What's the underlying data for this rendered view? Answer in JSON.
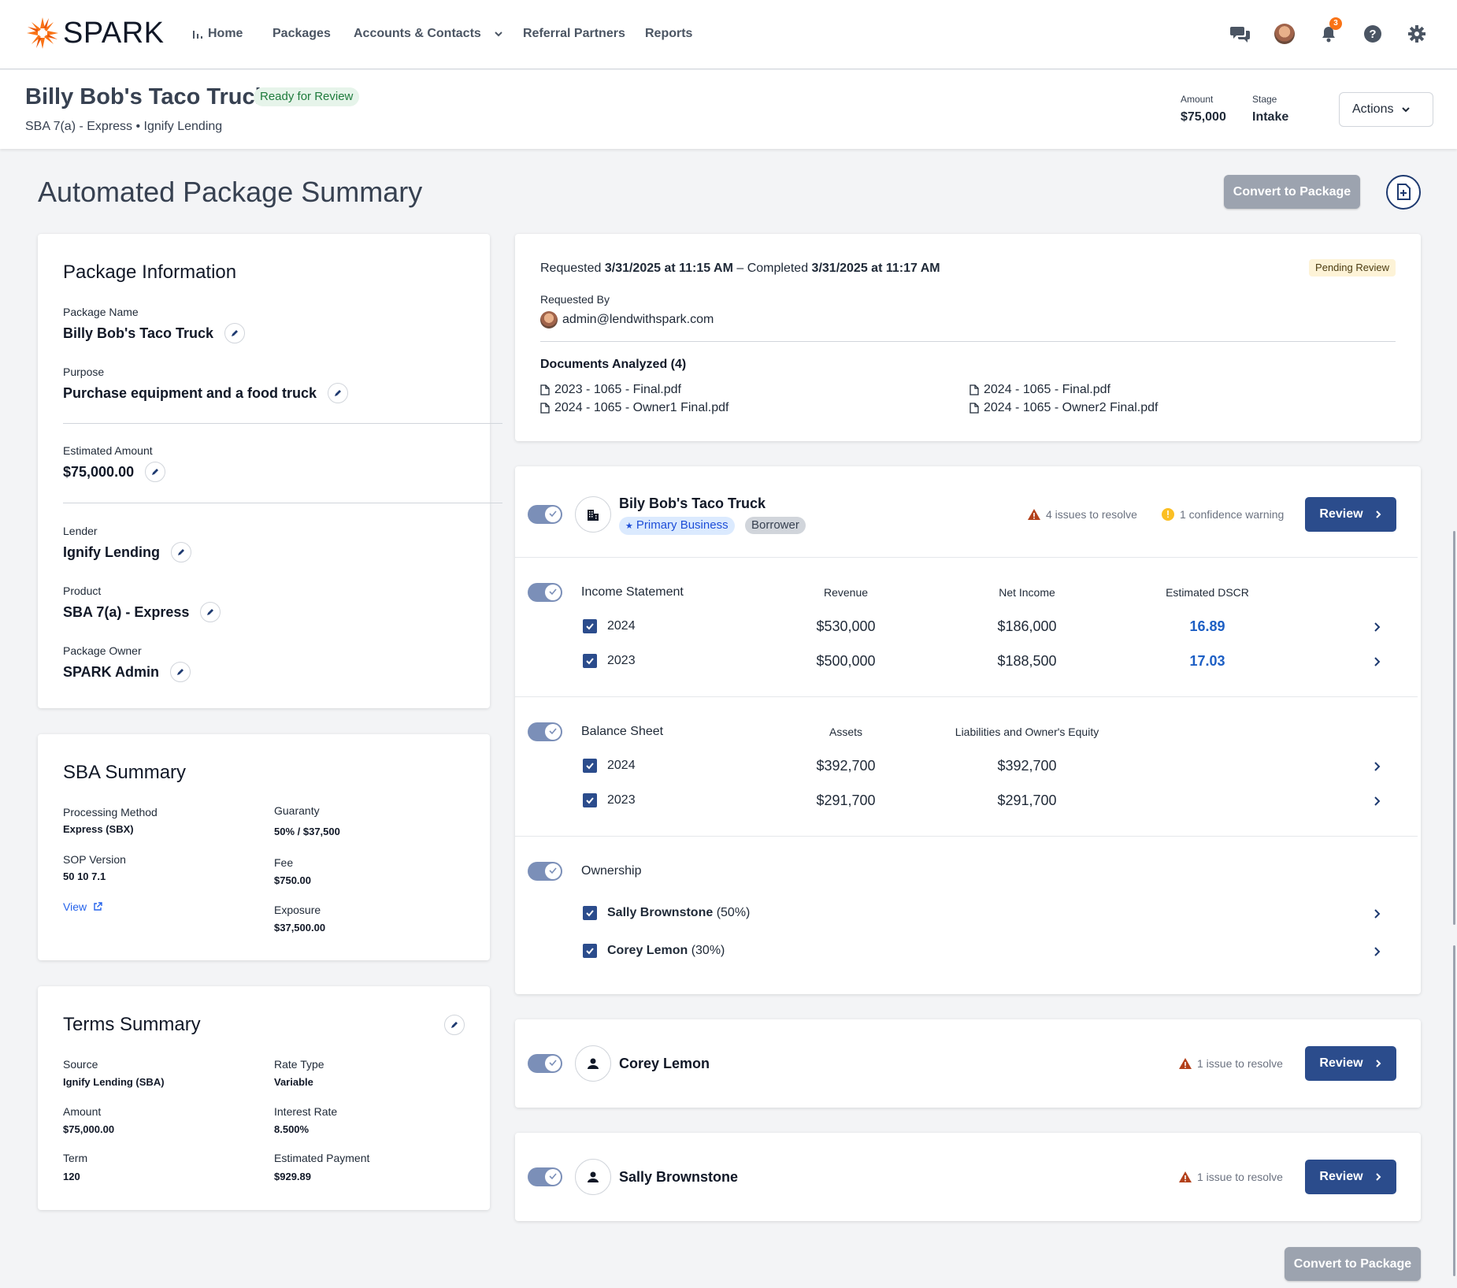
{
  "nav": {
    "brand": "SPARK",
    "links": [
      "Home",
      "Packages",
      "Accounts & Contacts",
      "Referral Partners",
      "Reports"
    ],
    "notification_count": "3",
    "brand_color": "#f97316"
  },
  "header": {
    "title": "Billy Bob's Taco Truck",
    "status": "Ready for Review",
    "subtitle": "SBA 7(a) - Express • Ignify Lending",
    "amount_label": "Amount",
    "amount_value": "$75,000",
    "stage_label": "Stage",
    "stage_value": "Intake",
    "actions_label": "Actions"
  },
  "page": {
    "title": "Automated Package Summary",
    "convert_label": "Convert to Package"
  },
  "package_info": {
    "title": "Package Information",
    "fields": [
      {
        "label": "Package Name",
        "value": "Billy Bob's Taco Truck"
      },
      {
        "label": "Purpose",
        "value": "Purchase equipment and a food truck"
      },
      {
        "label": "Estimated Amount",
        "value": "$75,000.00"
      },
      {
        "label": "Lender",
        "value": "Ignify Lending"
      },
      {
        "label": "Product",
        "value": "SBA 7(a) - Express"
      },
      {
        "label": "Package Owner",
        "value": "SPARK Admin"
      }
    ]
  },
  "sba_summary": {
    "title": "SBA Summary",
    "processing_method_label": "Processing Method",
    "processing_method": "Express (SBX)",
    "sop_label": "SOP Version",
    "sop": "50 10 7.1",
    "view_label": "View",
    "guaranty_label": "Guaranty",
    "guaranty": "50% / $37,500",
    "fee_label": "Fee",
    "fee": "$750.00",
    "exposure_label": "Exposure",
    "exposure": "$37,500.00"
  },
  "terms_summary": {
    "title": "Terms Summary",
    "source_label": "Source",
    "source": "Ignify Lending (SBA)",
    "amount_label": "Amount",
    "amount": "$75,000.00",
    "term_label": "Term",
    "term": "120",
    "rate_type_label": "Rate Type",
    "rate_type": "Variable",
    "interest_label": "Interest Rate",
    "interest": "8.500%",
    "payment_label": "Estimated Payment",
    "payment": "$929.89"
  },
  "request": {
    "requested_prefix": "Requested",
    "requested_at": "3/31/2025 at 11:15 AM",
    "completed_prefix": "– Completed",
    "completed_at": "3/31/2025 at 11:17 AM",
    "status": "Pending Review",
    "requested_by_label": "Requested By",
    "requested_by": "admin@lendwithspark.com",
    "documents_title": "Documents Analyzed (4)",
    "documents": [
      "2023 - 1065 - Final.pdf",
      "2024 - 1065 - Owner1 Final.pdf",
      "2024 - 1065 - Final.pdf",
      "2024 - 1065 - Owner2 Final.pdf"
    ]
  },
  "business": {
    "name": "Bily Bob's Taco Truck",
    "chip_primary": "Primary Business",
    "chip_role": "Borrower",
    "issues": "4 issues to resolve",
    "warnings": "1 confidence warning",
    "review_label": "Review",
    "income": {
      "title": "Income Statement",
      "headers": [
        "Revenue",
        "Net Income",
        "Estimated DSCR"
      ],
      "rows": [
        {
          "year": "2024",
          "revenue": "$530,000",
          "net_income": "$186,000",
          "dscr": "16.89"
        },
        {
          "year": "2023",
          "revenue": "$500,000",
          "net_income": "$188,500",
          "dscr": "17.03"
        }
      ]
    },
    "balance": {
      "title": "Balance Sheet",
      "headers": [
        "Assets",
        "Liabilities and Owner's Equity"
      ],
      "rows": [
        {
          "year": "2024",
          "assets": "$392,700",
          "liabilities": "$392,700"
        },
        {
          "year": "2023",
          "assets": "$291,700",
          "liabilities": "$291,700"
        }
      ]
    },
    "ownership": {
      "title": "Ownership",
      "owners": [
        {
          "name": "Sally Brownstone",
          "pct": "(50%)"
        },
        {
          "name": "Corey Lemon",
          "pct": "(30%)"
        }
      ]
    }
  },
  "people": [
    {
      "name": "Corey Lemon",
      "issues": "1 issue to resolve",
      "review_label": "Review"
    },
    {
      "name": "Sally Brownstone",
      "issues": "1 issue to resolve",
      "review_label": "Review"
    }
  ]
}
